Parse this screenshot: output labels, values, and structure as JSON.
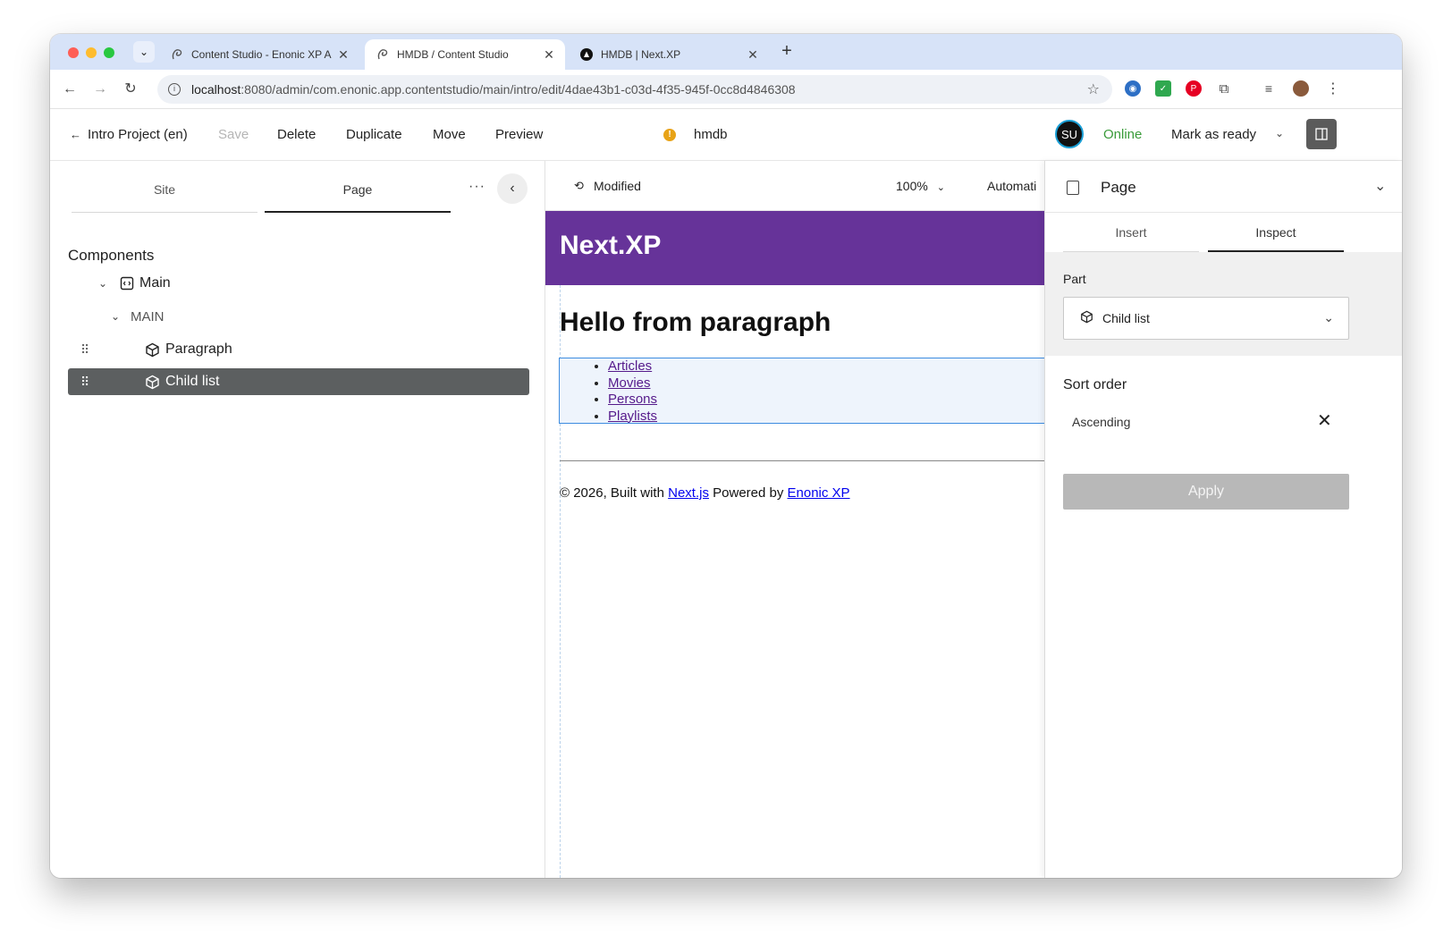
{
  "browser": {
    "tabs": [
      {
        "title": "Content Studio - Enonic XP A",
        "active": false
      },
      {
        "title": "HMDB / Content Studio",
        "active": true
      },
      {
        "title": "HMDB | Next.XP",
        "active": false
      }
    ],
    "url_host": "localhost",
    "url_path": ":8080/admin/com.enonic.app.contentstudio/main/intro/edit/4dae43b1-c03d-4f35-945f-0cc8d4846308"
  },
  "header": {
    "back_label": "Intro Project (en)",
    "save_label": "Save",
    "delete_label": "Delete",
    "duplicate_label": "Duplicate",
    "move_label": "Move",
    "preview_label": "Preview",
    "content_name": "hmdb",
    "avatar_initials": "SU",
    "status": "Online",
    "mark_ready_label": "Mark as ready"
  },
  "left_panel": {
    "tabs": [
      "Site",
      "Page"
    ],
    "more_label": "···",
    "components_title": "Components",
    "tree": [
      {
        "label": "Main",
        "kind": "page"
      },
      {
        "label": "MAIN",
        "kind": "region"
      },
      {
        "label": "Paragraph",
        "kind": "part"
      },
      {
        "label": "Child list",
        "kind": "part",
        "selected": true
      }
    ]
  },
  "preview": {
    "status": "Modified",
    "zoom": "100%",
    "device": "Automati",
    "site_brand": "Next.XP",
    "heading": "Hello from paragraph",
    "links": [
      "Articles",
      "Movies",
      "Persons",
      "Playlists"
    ],
    "footer_prefix": "© 2026, Built with ",
    "footer_link1": "Next.js",
    "footer_mid": " Powered by ",
    "footer_link2": "Enonic XP"
  },
  "right_panel": {
    "title": "Page",
    "tabs": [
      "Insert",
      "Inspect"
    ],
    "part_label": "Part",
    "part_value": "Child list",
    "sort_order_label": "Sort order",
    "sort_order_value": "Ascending",
    "apply_label": "Apply"
  },
  "colors": {
    "site_header": "#663399",
    "selected_row": "#5c5f60",
    "online": "#3a9b3a",
    "highlight_border": "#3d8ce0"
  }
}
